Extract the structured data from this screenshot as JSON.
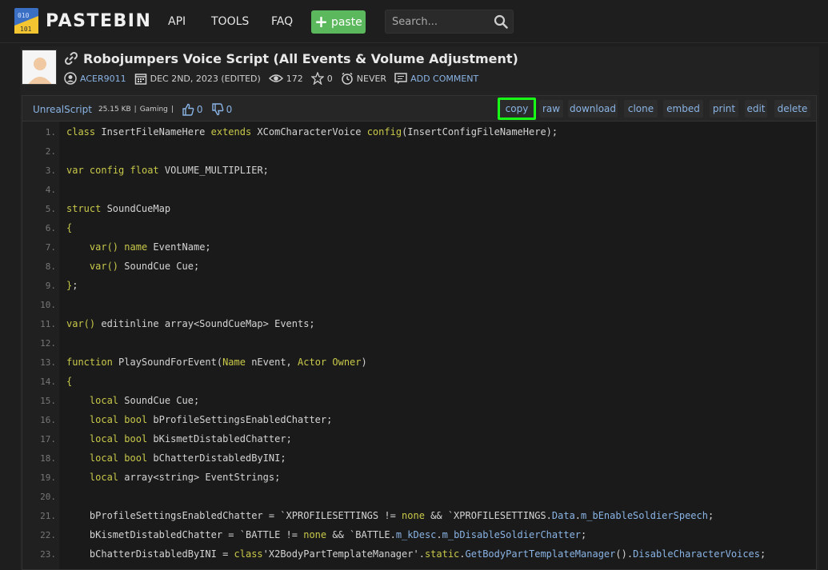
{
  "header": {
    "brand": "PASTEBIN",
    "nav": [
      "API",
      "TOOLS",
      "FAQ"
    ],
    "paste_label": "paste",
    "search_placeholder": "Search..."
  },
  "paste": {
    "title": "Robojumpers Voice Script (All Events & Volume Adjustment)",
    "author": "ACER9011",
    "date": "DEC 2ND, 2023 (EDITED)",
    "views": "172",
    "stars": "0",
    "expires": "NEVER",
    "comment_label": "ADD COMMENT"
  },
  "toolbar": {
    "language": "UnrealScript",
    "size": "25.15 KB",
    "category": "Gaming",
    "likes": "0",
    "dislikes": "0",
    "buttons": [
      "copy",
      "raw",
      "download",
      "clone",
      "embed",
      "print",
      "edit",
      "delete"
    ]
  },
  "code_lines": [
    "1.",
    "2.",
    "3.",
    "4.",
    "5.",
    "6.",
    "7.",
    "8.",
    "9.",
    "10.",
    "11.",
    "12.",
    "13.",
    "14.",
    "15.",
    "16.",
    "17.",
    "18.",
    "19.",
    "20.",
    "21.",
    "22.",
    "23."
  ],
  "colors": {
    "accent_green": "#5cb85c",
    "highlight": "#18ff18",
    "link_blue": "#8ab4e5"
  }
}
